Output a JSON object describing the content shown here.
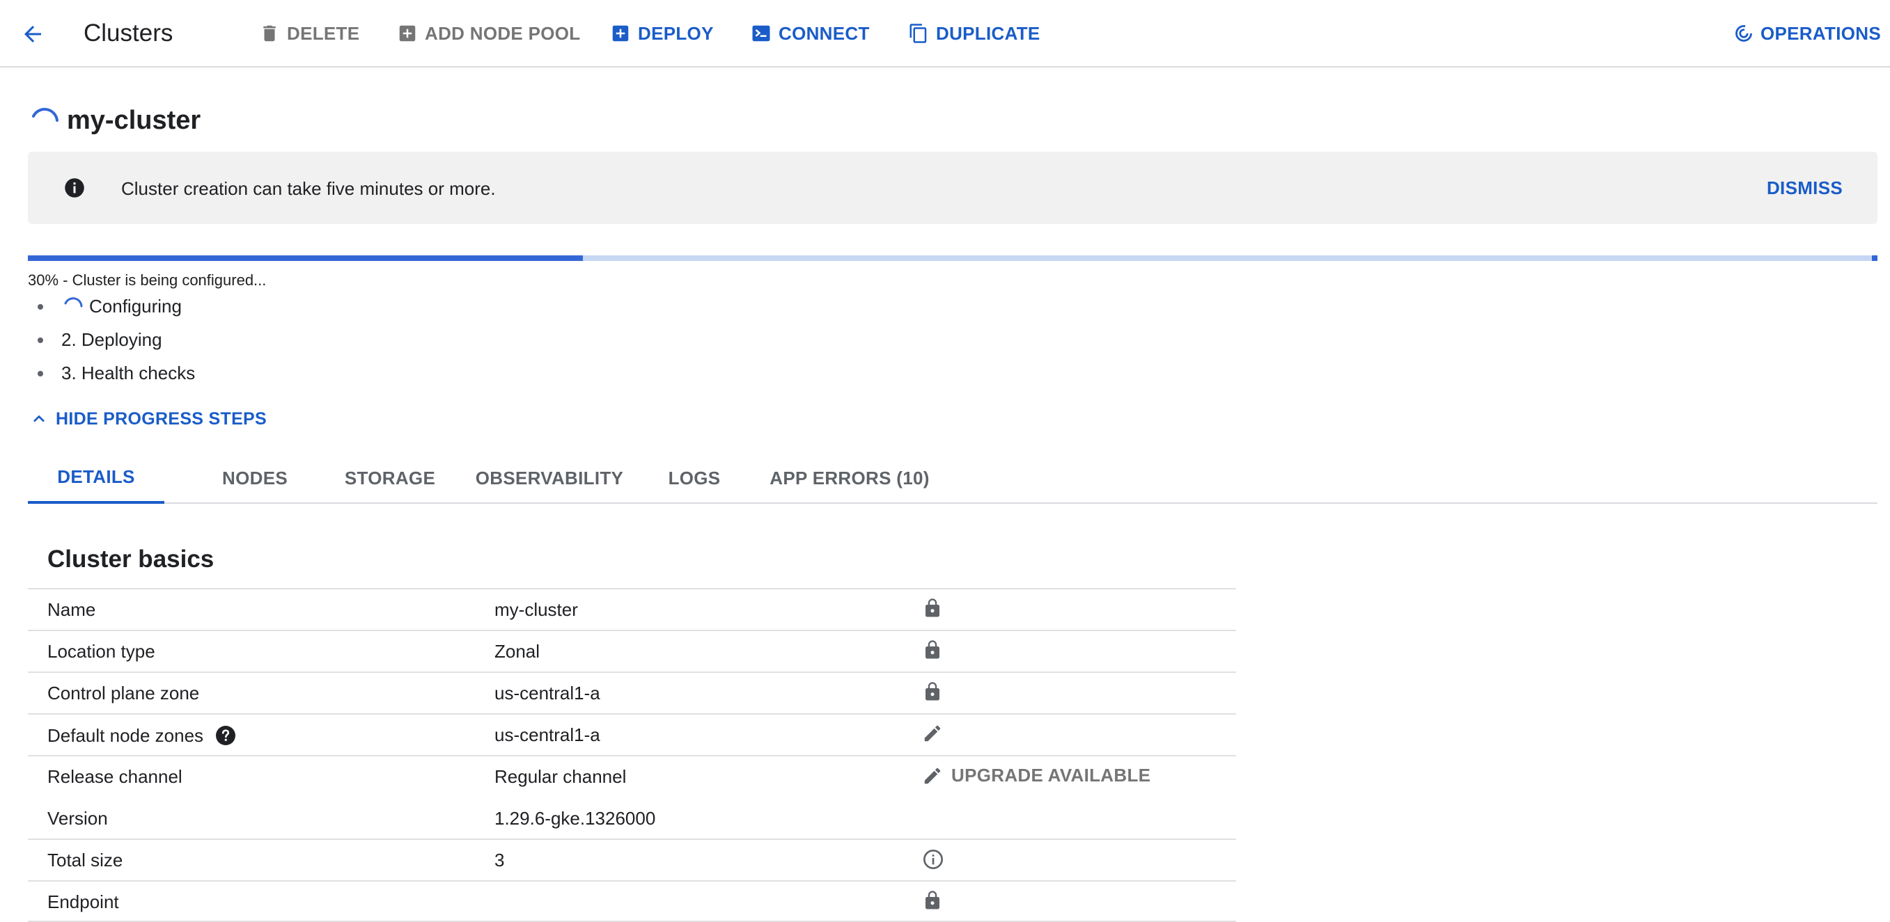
{
  "toolbar": {
    "title": "Clusters",
    "buttons": {
      "delete": "DELETE",
      "add_node_pool": "ADD NODE POOL",
      "deploy": "DEPLOY",
      "connect": "CONNECT",
      "duplicate": "DUPLICATE",
      "operations": "OPERATIONS"
    }
  },
  "cluster": {
    "name": "my-cluster"
  },
  "banner": {
    "icon": "info-icon",
    "message": "Cluster creation can take five minutes or more.",
    "dismiss_label": "DISMISS"
  },
  "progress": {
    "percent": 30,
    "status_text": "30% - Cluster is being configured...",
    "steps": [
      {
        "label": "Configuring",
        "state": "in-progress"
      },
      {
        "label": "2. Deploying",
        "state": "pending"
      },
      {
        "label": "3. Health checks",
        "state": "pending"
      }
    ],
    "toggle_label": "HIDE PROGRESS STEPS"
  },
  "tabs": [
    {
      "label": "DETAILS",
      "active": true
    },
    {
      "label": "NODES",
      "active": false
    },
    {
      "label": "STORAGE",
      "active": false
    },
    {
      "label": "OBSERVABILITY",
      "active": false
    },
    {
      "label": "LOGS",
      "active": false
    },
    {
      "label": "APP ERRORS (10)",
      "active": false
    }
  ],
  "details": {
    "section_title": "Cluster basics",
    "rows": [
      {
        "label": "Name",
        "value": "my-cluster",
        "action_icon": "lock-icon"
      },
      {
        "label": "Location type",
        "value": "Zonal",
        "action_icon": "lock-icon"
      },
      {
        "label": "Control plane zone",
        "value": "us-central1-a",
        "action_icon": "lock-icon"
      },
      {
        "label": "Default node zones",
        "value": "us-central1-a",
        "action_icon": "edit-icon",
        "help_icon": "help-icon"
      },
      {
        "label": "Release channel",
        "value": "Regular channel",
        "action_icon": "edit-icon",
        "action_label": "UPGRADE AVAILABLE"
      },
      {
        "label": "Version",
        "value": "1.29.6-gke.1326000"
      },
      {
        "label": "Total size",
        "value": "3",
        "action_icon": "info-outline-icon"
      },
      {
        "label": "Endpoint",
        "value": "",
        "action_icon": "lock-icon"
      }
    ]
  },
  "colors": {
    "accent": "#1a5cc8",
    "progress_fill": "#3367d6",
    "progress_track": "#c6d7f4",
    "disabled_text": "#757575",
    "banner_bg": "#f1f1f1"
  }
}
